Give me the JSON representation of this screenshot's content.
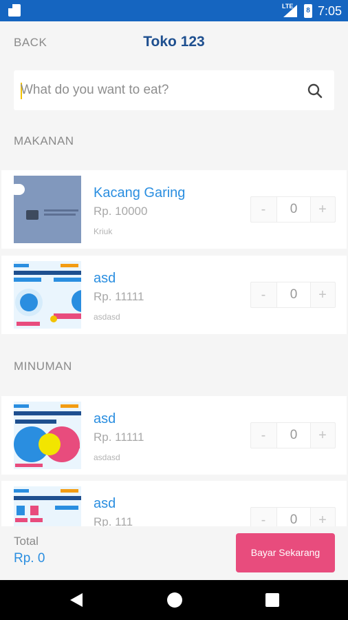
{
  "status_bar": {
    "time": "7:05",
    "network": "LTE",
    "battery": "8"
  },
  "header": {
    "back_label": "BACK",
    "title": "Toko 123"
  },
  "search": {
    "placeholder": "What do you want to eat?"
  },
  "sections": [
    {
      "label": "MAKANAN",
      "items": [
        {
          "name": "Kacang Garing",
          "price": "Rp. 10000",
          "desc": "Kriuk",
          "qty": "0"
        },
        {
          "name": "asd",
          "price": "Rp. 11111",
          "desc": "asdasd",
          "qty": "0"
        }
      ]
    },
    {
      "label": "MINUMAN",
      "items": [
        {
          "name": "asd",
          "price": "Rp. 11111",
          "desc": "asdasd",
          "qty": "0"
        },
        {
          "name": "asd",
          "price": "Rp. 111",
          "desc": "",
          "qty": "0"
        }
      ]
    }
  ],
  "stepper": {
    "minus": "-",
    "plus": "+"
  },
  "footer": {
    "total_label": "Total",
    "total_value": "Rp. 0",
    "pay_button": "Bayar Sekarang"
  },
  "colors": {
    "status_bar": "#1565c0",
    "title": "#1e4f8f",
    "accent": "#2a8ee0",
    "pay_button": "#e84c7d"
  }
}
